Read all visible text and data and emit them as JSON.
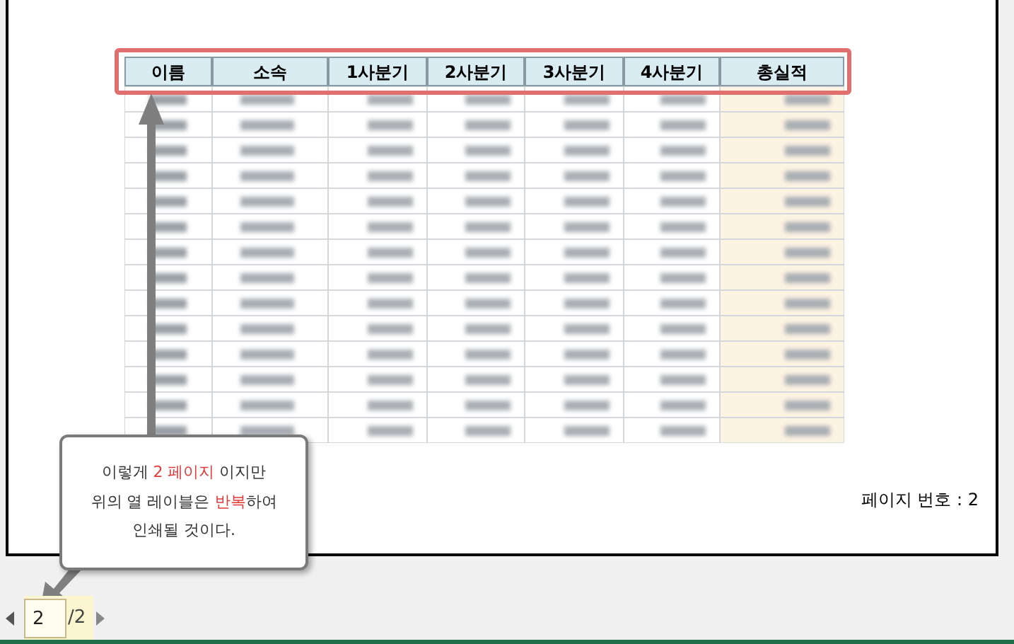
{
  "table": {
    "columns": [
      "이름",
      "소속",
      "1사분기",
      "2사분기",
      "3사분기",
      "4사분기",
      "총실적"
    ],
    "header_highlighted": true
  },
  "page_footer": "페이지 번호 : 2",
  "callout": {
    "lines": [
      [
        {
          "text": "이렇게 ",
          "highlight": false
        },
        {
          "text": "2 페이지",
          "highlight": true
        },
        {
          "text": " 이지만",
          "highlight": false
        }
      ],
      [
        {
          "text": "위의 열 레이블은 ",
          "highlight": false
        },
        {
          "text": "반복",
          "highlight": true
        },
        {
          "text": "하여",
          "highlight": false
        }
      ],
      [
        {
          "text": "인쇄될 것이다.",
          "highlight": false
        }
      ]
    ]
  },
  "pager": {
    "value": "2",
    "total": "/2"
  }
}
